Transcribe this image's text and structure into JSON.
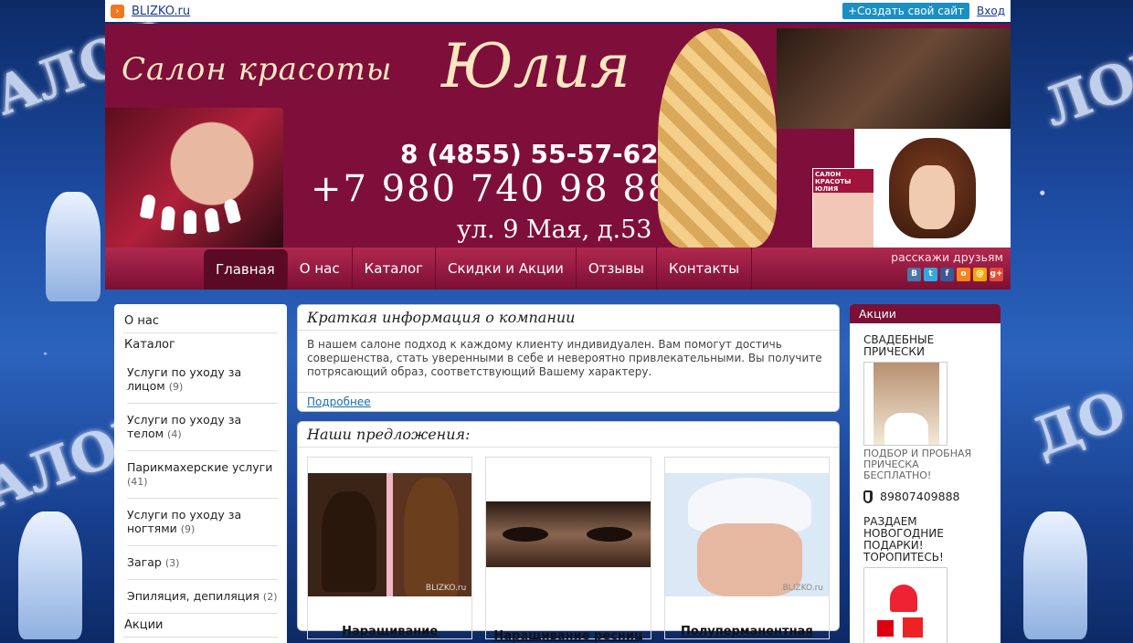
{
  "topbar": {
    "site_link": "BLIZKO.ru",
    "create_button": "+Создать свой сайт",
    "login_link": "Вход"
  },
  "header": {
    "salon_title": "Салон красоты",
    "salon_name": "Юлия",
    "phone_1": "8 (4855) 55-57-62",
    "phone_2": "+7 980 740 98 88",
    "address": "ул. 9 Мая, д.53",
    "magazine_text": "САЛОН КРАСОТЫ ЮЛИЯ"
  },
  "nav": {
    "items": [
      "Главная",
      "О нас",
      "Каталог",
      "Скидки и Акции",
      "Отзывы",
      "Контакты"
    ],
    "active_index": 0,
    "share_label": "расскажи друзьям",
    "share_icons": [
      {
        "icon": "vk-icon",
        "glyph": "В",
        "color": "#4a76a8"
      },
      {
        "icon": "twitter-icon",
        "glyph": "t",
        "color": "#2fa9e0"
      },
      {
        "icon": "facebook-icon",
        "glyph": "f",
        "color": "#3b5998"
      },
      {
        "icon": "odnoklassniki-icon",
        "glyph": "o",
        "color": "#f48420"
      },
      {
        "icon": "mail-icon",
        "glyph": "@",
        "color": "#f0a500"
      },
      {
        "icon": "googleplus-icon",
        "glyph": "g+",
        "color": "#dd4b39"
      }
    ]
  },
  "sidebar": {
    "about": "О нас",
    "catalog": "Каталог",
    "categories": [
      {
        "name": "Услуги по уходу за лицом",
        "count": "(9)"
      },
      {
        "name": "Услуги по уходу за телом",
        "count": "(4)"
      },
      {
        "name": "Парикмахерские услуги",
        "count": "(41)"
      },
      {
        "name": "Услуги по уходу за ногтями",
        "count": "(9)"
      },
      {
        "name": "Загар",
        "count": "(3)"
      },
      {
        "name": "Эпиляция, депиляция",
        "count": "(2)"
      }
    ],
    "promos": "Акции"
  },
  "info": {
    "title": "Краткая информация о компании",
    "text": "В нашем салоне подход к каждому клиенту индивидуален. Вам помогут достичь совершенства, стать уверенными в себе и невероятно привлекательными. Вы получите потрясающий образ, соответствующий Вашему характеру.",
    "more_link": "Подробнее"
  },
  "offers": {
    "title": "Наши предложения:",
    "items": [
      {
        "label": "Наращивание"
      },
      {
        "label": "Наращивание ресниц"
      },
      {
        "label": "Полуперманентная"
      }
    ],
    "watermark": "BLIZKO.ru"
  },
  "promo": {
    "header": "Акции",
    "item1_title": "СВАДЕБНЫЕ ПРИЧЕСКИ",
    "item1_sub": "ПОДБОР И ПРОБНАЯ ПРИЧЕСКА БЕСПЛАТНО!",
    "phone": "89807409888",
    "item2_title": "РАЗДАЕМ НОВОГОДНИЕ ПОДАРКИ! ТОРОПИТЕСЬ!"
  },
  "background": {
    "word": "ДОБРО ПОЖАЛОВАТЬ",
    "theme_color": "#7e0f3a"
  }
}
